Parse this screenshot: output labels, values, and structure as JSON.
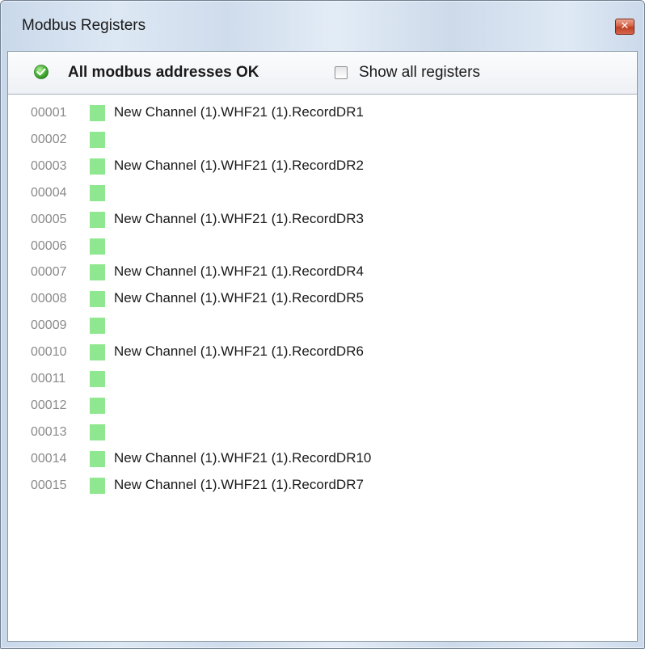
{
  "window": {
    "title": "Modbus Registers",
    "close_glyph": "✕"
  },
  "status": {
    "icon": "green-check-icon",
    "text": "All modbus addresses OK"
  },
  "show_all": {
    "label": "Show all registers",
    "checked": false
  },
  "colors": {
    "ok_status": "#8fe88f",
    "address_text": "#8a8a8a"
  },
  "registers": [
    {
      "address": "00001",
      "name": "New Channel (1).WHF21 (1).RecordDR1"
    },
    {
      "address": "00002",
      "name": ""
    },
    {
      "address": "00003",
      "name": "New Channel (1).WHF21 (1).RecordDR2"
    },
    {
      "address": "00004",
      "name": ""
    },
    {
      "address": "00005",
      "name": "New Channel (1).WHF21 (1).RecordDR3"
    },
    {
      "address": "00006",
      "name": ""
    },
    {
      "address": "00007",
      "name": "New Channel (1).WHF21 (1).RecordDR4"
    },
    {
      "address": "00008",
      "name": "New Channel (1).WHF21 (1).RecordDR5"
    },
    {
      "address": "00009",
      "name": ""
    },
    {
      "address": "00010",
      "name": "New Channel (1).WHF21 (1).RecordDR6"
    },
    {
      "address": "00011",
      "name": ""
    },
    {
      "address": "00012",
      "name": ""
    },
    {
      "address": "00013",
      "name": ""
    },
    {
      "address": "00014",
      "name": "New Channel (1).WHF21 (1).RecordDR10"
    },
    {
      "address": "00015",
      "name": "New Channel (1).WHF21 (1).RecordDR7"
    }
  ]
}
